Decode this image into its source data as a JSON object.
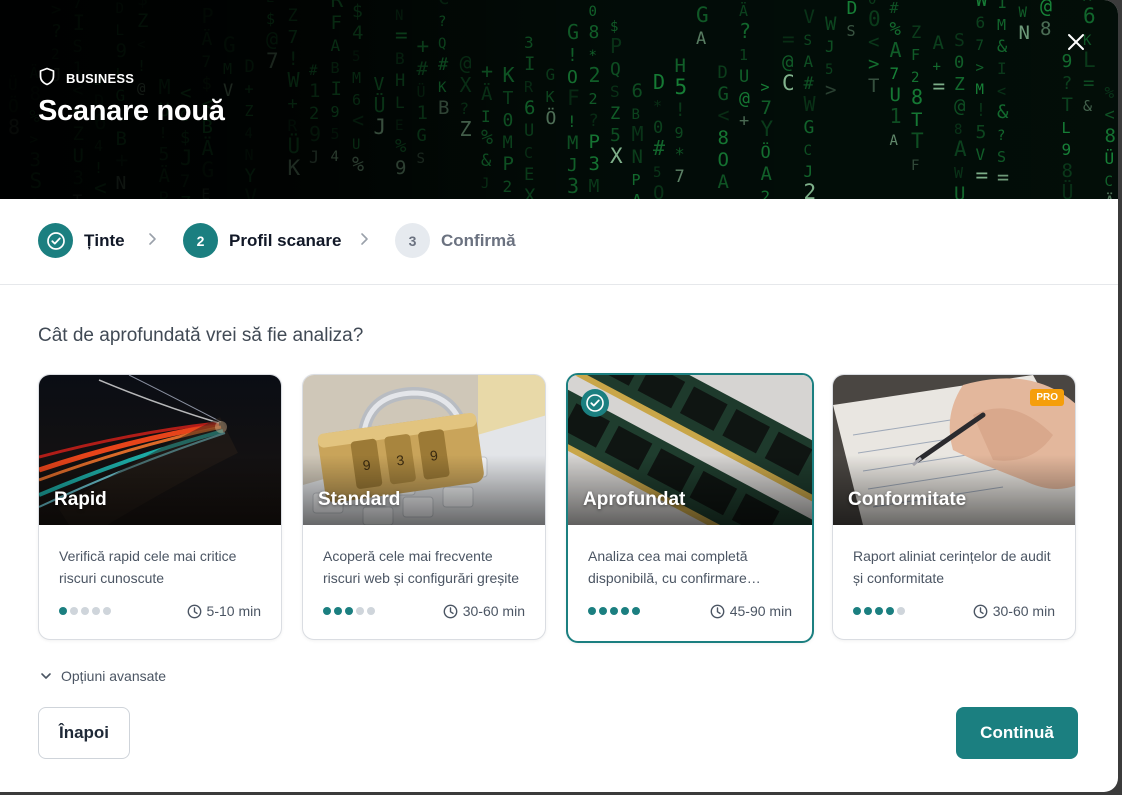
{
  "header": {
    "plan_label": "BUSINESS",
    "title": "Scanare nouă",
    "close_icon": "close-icon"
  },
  "stepper": {
    "steps": [
      {
        "number": "1",
        "label": "Ținte",
        "state": "done"
      },
      {
        "number": "2",
        "label": "Profil scanare",
        "state": "active"
      },
      {
        "number": "3",
        "label": "Confirmă",
        "state": "todo"
      }
    ]
  },
  "main": {
    "question": "Cât de aprofundată vrei să fie analiza?",
    "profiles": [
      {
        "title": "Rapid",
        "description": "Verifică rapid cele mai critice riscuri cunoscute",
        "depth_level": 1,
        "depth_max": 5,
        "duration": "5-10 min",
        "selected": false,
        "badge": ""
      },
      {
        "title": "Standard",
        "description": "Acoperă cele mai frecvente riscuri web și configurări greșite",
        "depth_level": 3,
        "depth_max": 5,
        "duration": "30-60 min",
        "selected": false,
        "badge": ""
      },
      {
        "title": "Aprofundat",
        "description": "Analiza cea mai completă disponibilă, cu confirmare manuală",
        "depth_level": 5,
        "depth_max": 5,
        "duration": "45-90 min",
        "selected": true,
        "badge": ""
      },
      {
        "title": "Conformitate",
        "description": "Raport aliniat cerințelor de audit și conformitate",
        "depth_level": 4,
        "depth_max": 5,
        "duration": "30-60 min",
        "selected": false,
        "badge": "PRO"
      }
    ],
    "advanced_label": "Opțiuni avansate"
  },
  "footer": {
    "back_label": "Înapoi",
    "continue_label": "Continuă"
  },
  "colors": {
    "accent": "#1b7f80",
    "pro_badge": "#f59e0b",
    "header_bg": "#03100a"
  }
}
